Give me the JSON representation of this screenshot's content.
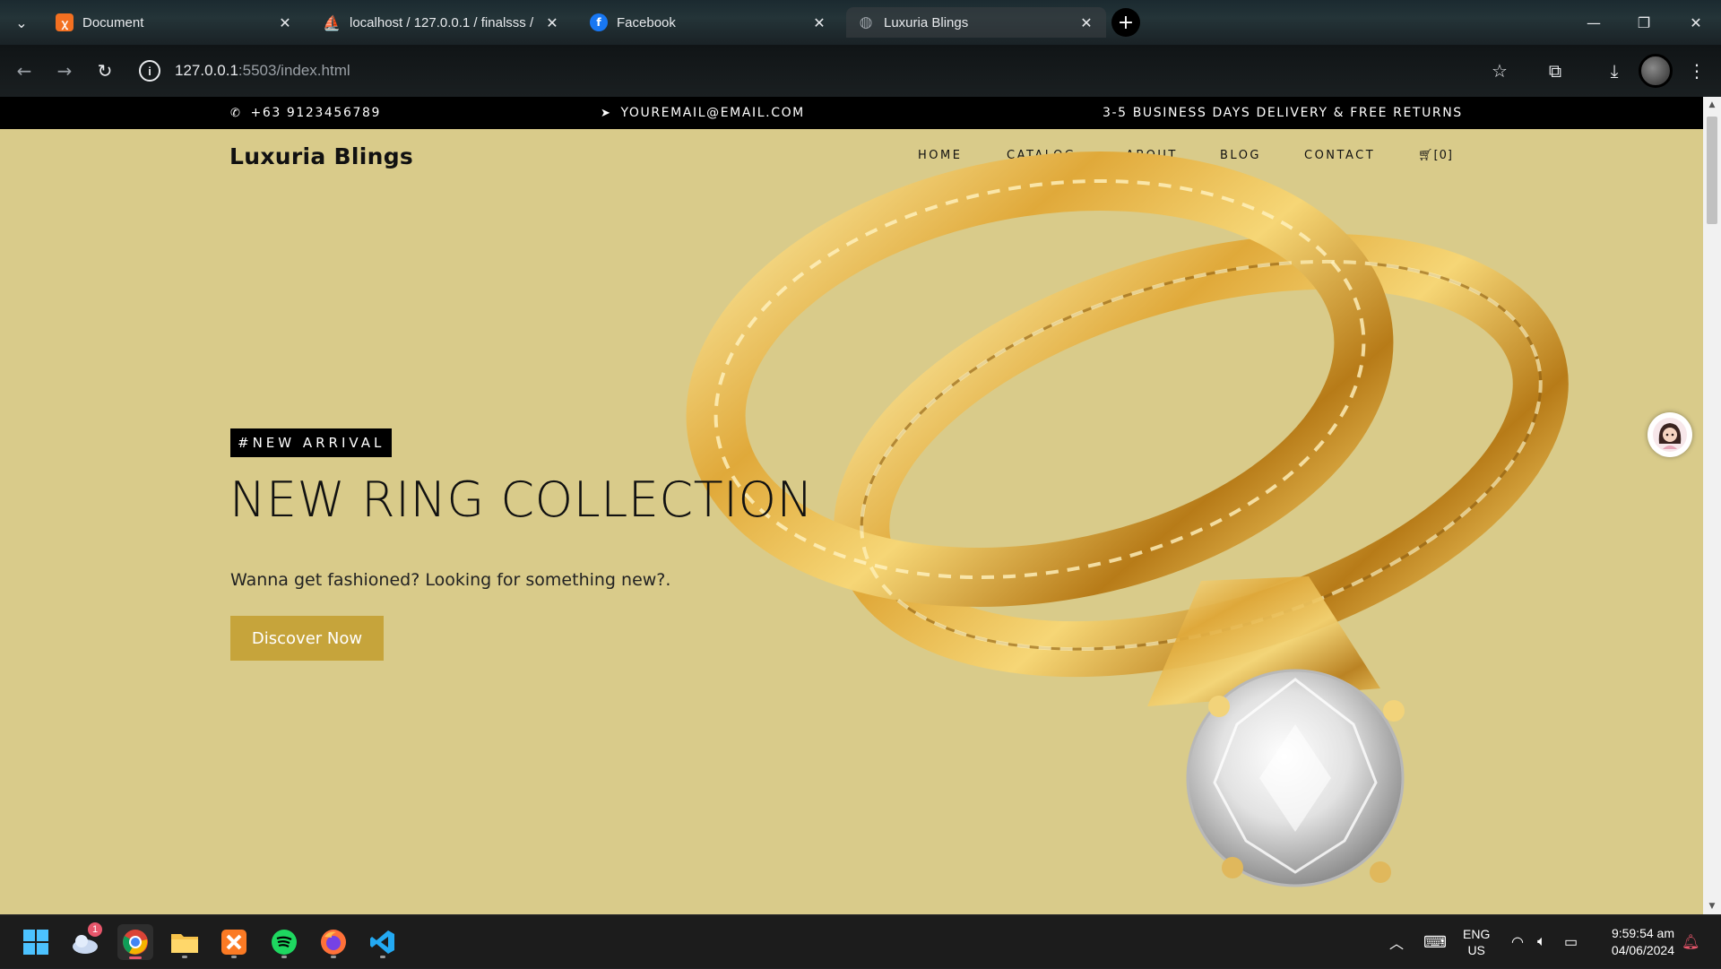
{
  "browser": {
    "tabs": [
      {
        "title": "Document",
        "favicon": "xampp-icon",
        "active": false
      },
      {
        "title": "localhost / 127.0.0.1 / finalsss / ...",
        "favicon": "phpmyadmin-icon",
        "active": false
      },
      {
        "title": "Facebook",
        "favicon": "facebook-icon",
        "active": false
      },
      {
        "title": "Luxuria Blings",
        "favicon": "globe-icon",
        "active": true
      }
    ],
    "url_host": "127.0.0.1",
    "url_rest": ":5503/index.html"
  },
  "site": {
    "topbar": {
      "phone": "+63 9123456789",
      "email": "YOUREMAIL@EMAIL.COM",
      "promo": "3-5 BUSINESS DAYS DELIVERY & FREE RETURNS"
    },
    "brand": "Luxuria Blings",
    "nav": {
      "home": "HOME",
      "catalog": "CATALOG",
      "about": "ABOUT",
      "blog": "BLOG",
      "contact": "CONTACT",
      "cart": "[0]"
    },
    "hero": {
      "badge": "#NEW ARRIVAL",
      "title": "NEW RING COLLECTION",
      "subtitle": "Wanna get fashioned? Looking for something new?.",
      "cta": "Discover Now"
    }
  },
  "taskbar": {
    "notification_count": "1",
    "lang": "ENG",
    "region": "US",
    "time": "9:59:54 am",
    "date": "04/06/2024"
  },
  "colors": {
    "page_bg": "#d9cb8a",
    "cta": "#c6a43b",
    "gold_light": "#f5d77a",
    "gold_dark": "#a8761a"
  }
}
